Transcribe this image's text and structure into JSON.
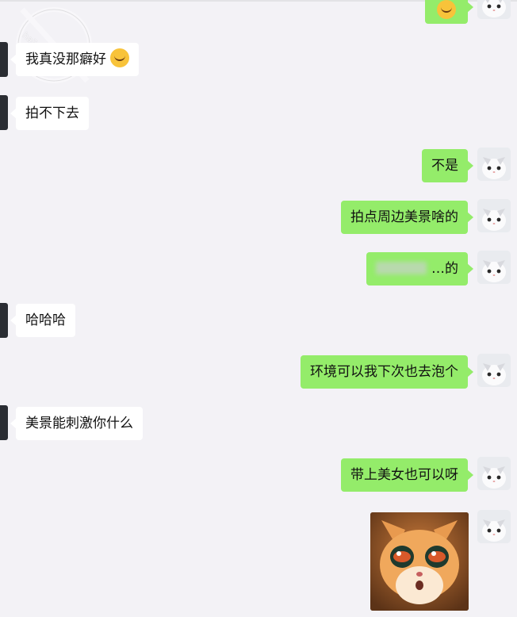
{
  "messages": [
    {
      "side": "right",
      "type": "emoji",
      "emoji": "smiling-face-emoji"
    },
    {
      "side": "left",
      "text": "我真没那癖好",
      "emoji": "laughing-crying-emoji"
    },
    {
      "side": "left",
      "text": "拍不下去"
    },
    {
      "side": "right",
      "text": "不是"
    },
    {
      "side": "right",
      "text": "拍点周边美景啥的"
    },
    {
      "side": "right",
      "text": "…的",
      "blurred": true
    },
    {
      "side": "left",
      "text": "哈哈哈"
    },
    {
      "side": "right",
      "text": "环境可以我下次也去泡个"
    },
    {
      "side": "left",
      "text": "美景能刺激你什么"
    },
    {
      "side": "right",
      "text": "带上美女也可以呀"
    },
    {
      "side": "right",
      "type": "sticker",
      "sticker": "cat-sticker"
    }
  ],
  "watermark": {
    "text": "haiju...com"
  },
  "colors": {
    "background": "#f3f2f6",
    "bubble_right": "#94ec6a",
    "bubble_left": "#ffffff"
  }
}
